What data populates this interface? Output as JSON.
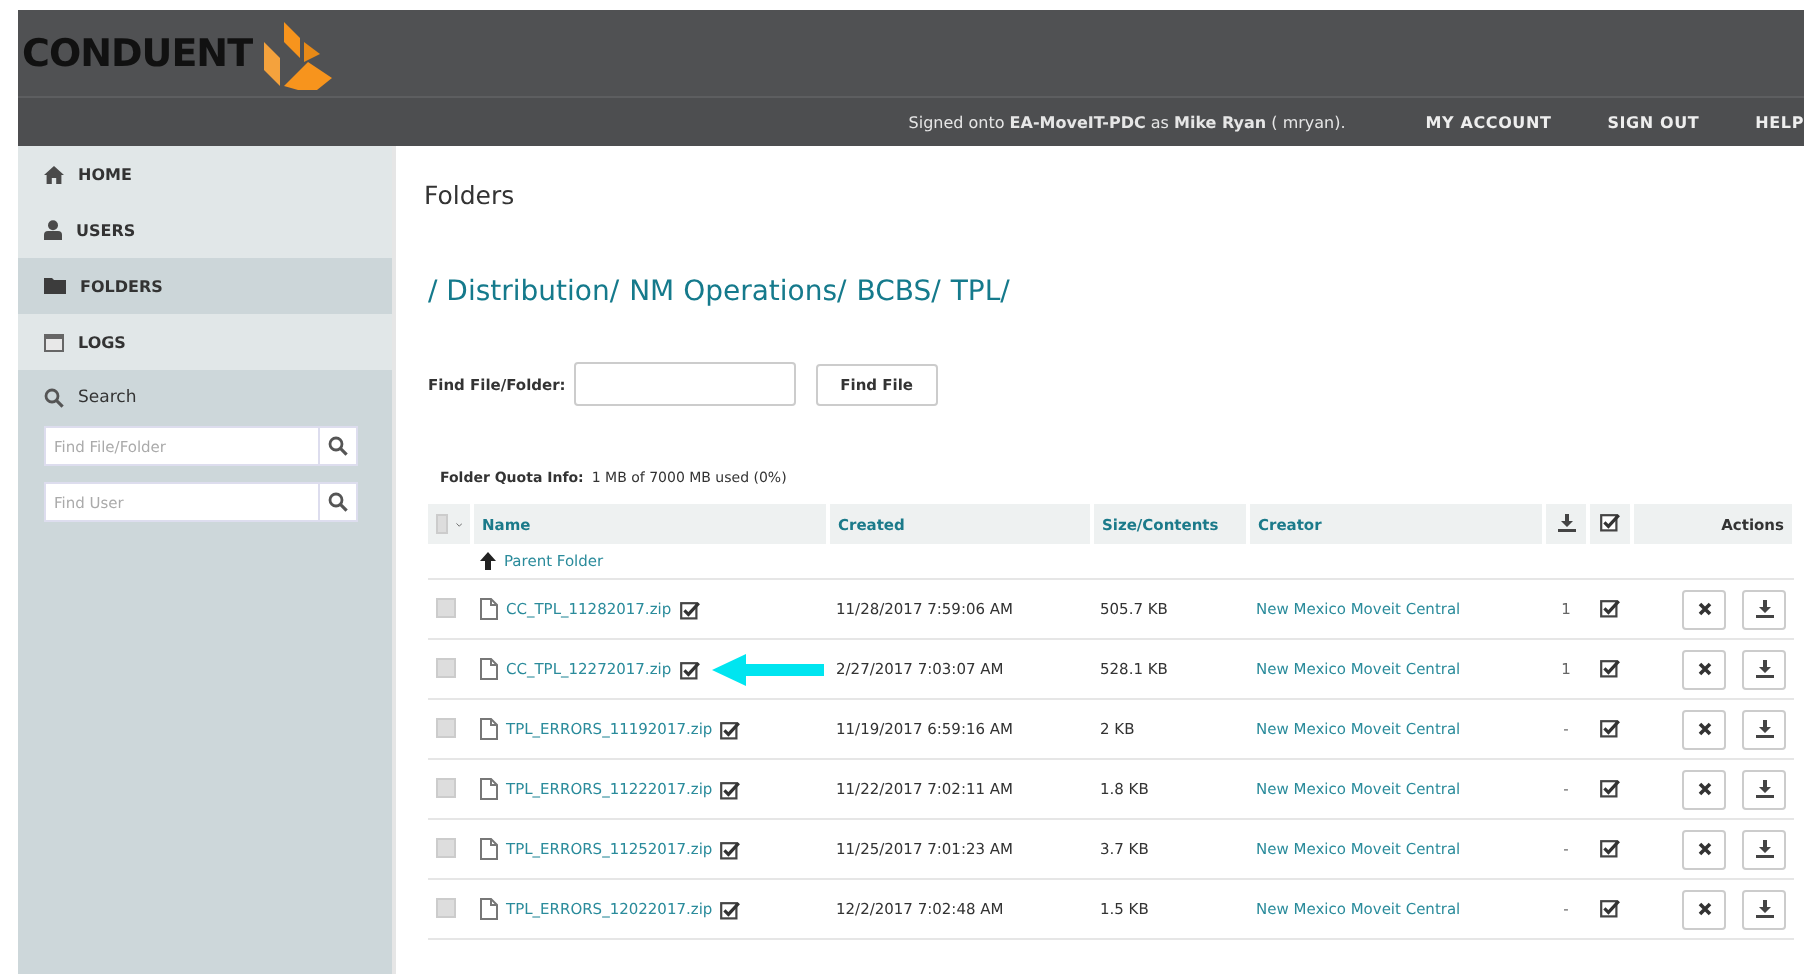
{
  "header": {
    "logo": "CONDUENT",
    "signed_in": "Signed onto **EA-MoveIT-PDC** as **Mike Ryan** ( mryan).",
    "links": [
      "MY ACCOUNT",
      "SIGN OUT",
      "HELP"
    ]
  },
  "sidebar": {
    "items": [
      {
        "label": "HOME",
        "selected": false
      },
      {
        "label": "USERS",
        "selected": false
      },
      {
        "label": "FOLDERS",
        "selected": true
      },
      {
        "label": "LOGS",
        "selected": false
      }
    ],
    "search": {
      "label": "Search",
      "fields": [
        {
          "placeholder": "Find File/Folder"
        },
        {
          "placeholder": "Find User"
        }
      ]
    }
  },
  "main": {
    "title": "Folders",
    "breadcrumb": [
      "/ Distribution/",
      "NM Operations/",
      "BCBS/",
      "TPL/"
    ],
    "find": {
      "label": "Find File/Folder:",
      "button": "Find File"
    },
    "quota": {
      "label": "Folder Quota Info:",
      "value": "1 MB of 7000 MB used (0%)"
    },
    "table": {
      "select_all_checked": false,
      "columns": [
        "Name",
        "Created",
        "Size/Contents",
        "Creator",
        "Actions"
      ],
      "parent_link": "Parent Folder",
      "rows": [
        {
          "checked": false,
          "name": "CC_TPL_11282017.zip",
          "created": "11/28/2017 7:59:06 AM",
          "size": "505.7 KB",
          "creator": "New Mexico Moveit Central",
          "downloads": "1",
          "integrity": true,
          "annotated": false
        },
        {
          "checked": false,
          "name": "CC_TPL_12272017.zip",
          "created": "2/27/2017 7:03:07 AM",
          "size": "528.1 KB",
          "creator": "New Mexico Moveit Central",
          "downloads": "1",
          "integrity": true,
          "annotated": true
        },
        {
          "checked": false,
          "name": "TPL_ERRORS_11192017.zip",
          "created": "11/19/2017 6:59:16 AM",
          "size": "2 KB",
          "creator": "New Mexico Moveit Central",
          "downloads": "-",
          "integrity": true,
          "annotated": false
        },
        {
          "checked": false,
          "name": "TPL_ERRORS_11222017.zip",
          "created": "11/22/2017 7:02:11 AM",
          "size": "1.8 KB",
          "creator": "New Mexico Moveit Central",
          "downloads": "-",
          "integrity": true,
          "annotated": false
        },
        {
          "checked": false,
          "name": "TPL_ERRORS_11252017.zip",
          "created": "11/25/2017 7:01:23 AM",
          "size": "3.7 KB",
          "creator": "New Mexico Moveit Central",
          "downloads": "-",
          "integrity": true,
          "annotated": false
        },
        {
          "checked": false,
          "name": "TPL_ERRORS_12022017.zip",
          "created": "12/2/2017 7:02:48 AM",
          "size": "1.5 KB",
          "creator": "New Mexico Moveit Central",
          "downloads": "-",
          "integrity": true,
          "annotated": false
        }
      ]
    }
  }
}
